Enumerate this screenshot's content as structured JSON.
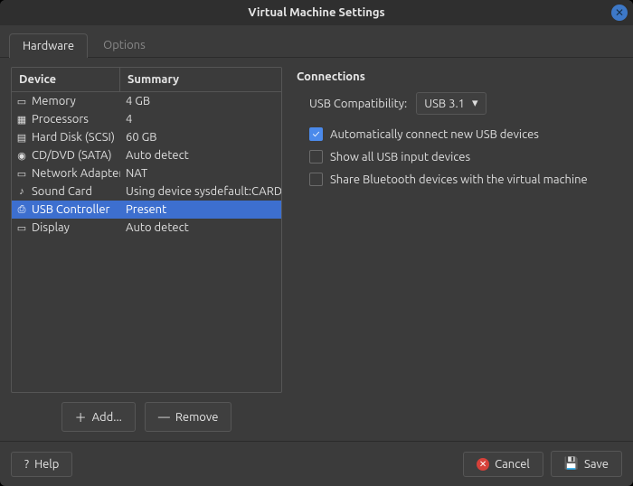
{
  "window": {
    "title": "Virtual Machine Settings"
  },
  "tabs": {
    "hardware": "Hardware",
    "options": "Options",
    "active": "hardware"
  },
  "table": {
    "header_device": "Device",
    "header_summary": "Summary",
    "rows": [
      {
        "icon": "memory-icon",
        "device": "Memory",
        "summary": "4 GB",
        "selected": false
      },
      {
        "icon": "cpu-icon",
        "device": "Processors",
        "summary": "4",
        "selected": false
      },
      {
        "icon": "disk-icon",
        "device": "Hard Disk (SCSI)",
        "summary": "60 GB",
        "selected": false
      },
      {
        "icon": "cd-icon",
        "device": "CD/DVD (SATA)",
        "summary": "Auto detect",
        "selected": false
      },
      {
        "icon": "network-icon",
        "device": "Network Adapter",
        "summary": "NAT",
        "selected": false
      },
      {
        "icon": "sound-icon",
        "device": "Sound Card",
        "summary": "Using device sysdefault:CARD=",
        "selected": false
      },
      {
        "icon": "usb-icon",
        "device": "USB Controller",
        "summary": "Present",
        "selected": true
      },
      {
        "icon": "display-icon",
        "device": "Display",
        "summary": "Auto detect",
        "selected": false
      }
    ]
  },
  "left_buttons": {
    "add": "Add...",
    "remove": "Remove"
  },
  "right": {
    "section": "Connections",
    "compat_label": "USB Compatibility:",
    "compat_value": "USB 3.1",
    "check_auto": {
      "label": "Automatically connect new USB devices",
      "checked": true
    },
    "check_show": {
      "label": "Show all USB input devices",
      "checked": false
    },
    "check_bt": {
      "label": "Share Bluetooth devices with the virtual machine",
      "checked": false
    }
  },
  "bottom": {
    "help": "Help",
    "cancel": "Cancel",
    "save": "Save"
  },
  "icons": {
    "memory": "▭",
    "cpu": "▦",
    "disk": "▤",
    "cd": "◉",
    "network": "▭",
    "sound": "♪",
    "usb": "⎙",
    "display": "▭",
    "plus": "＋",
    "minus": "—",
    "dropdown": "▾",
    "check": "✓",
    "help": "?",
    "close": "✕",
    "cancel": "✕",
    "save": "💾"
  }
}
